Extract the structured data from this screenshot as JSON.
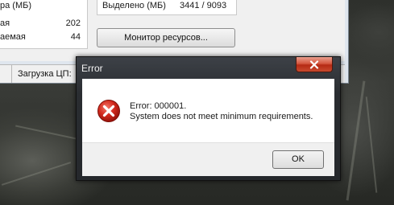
{
  "task_manager": {
    "stats": [
      {
        "label": "ра (МБ)",
        "value": ""
      },
      {
        "label": "ая",
        "value": "202"
      },
      {
        "label": "аемая",
        "value": "44"
      }
    ],
    "committed": {
      "label": "Выделено (МБ)",
      "value": "3441 / 9093"
    },
    "resource_monitor_button": "Монитор ресурсов...",
    "status_bar": {
      "cpu_label": "Загрузка ЦП:"
    }
  },
  "dialog": {
    "title": "Error",
    "icon": "error-x-icon",
    "message_line1": "Error: 000001.",
    "message_line2": "System does not meet minimum requirements.",
    "ok_label": "OK"
  },
  "colors": {
    "error_red": "#c7261b",
    "close_button": "#c84a2f"
  }
}
